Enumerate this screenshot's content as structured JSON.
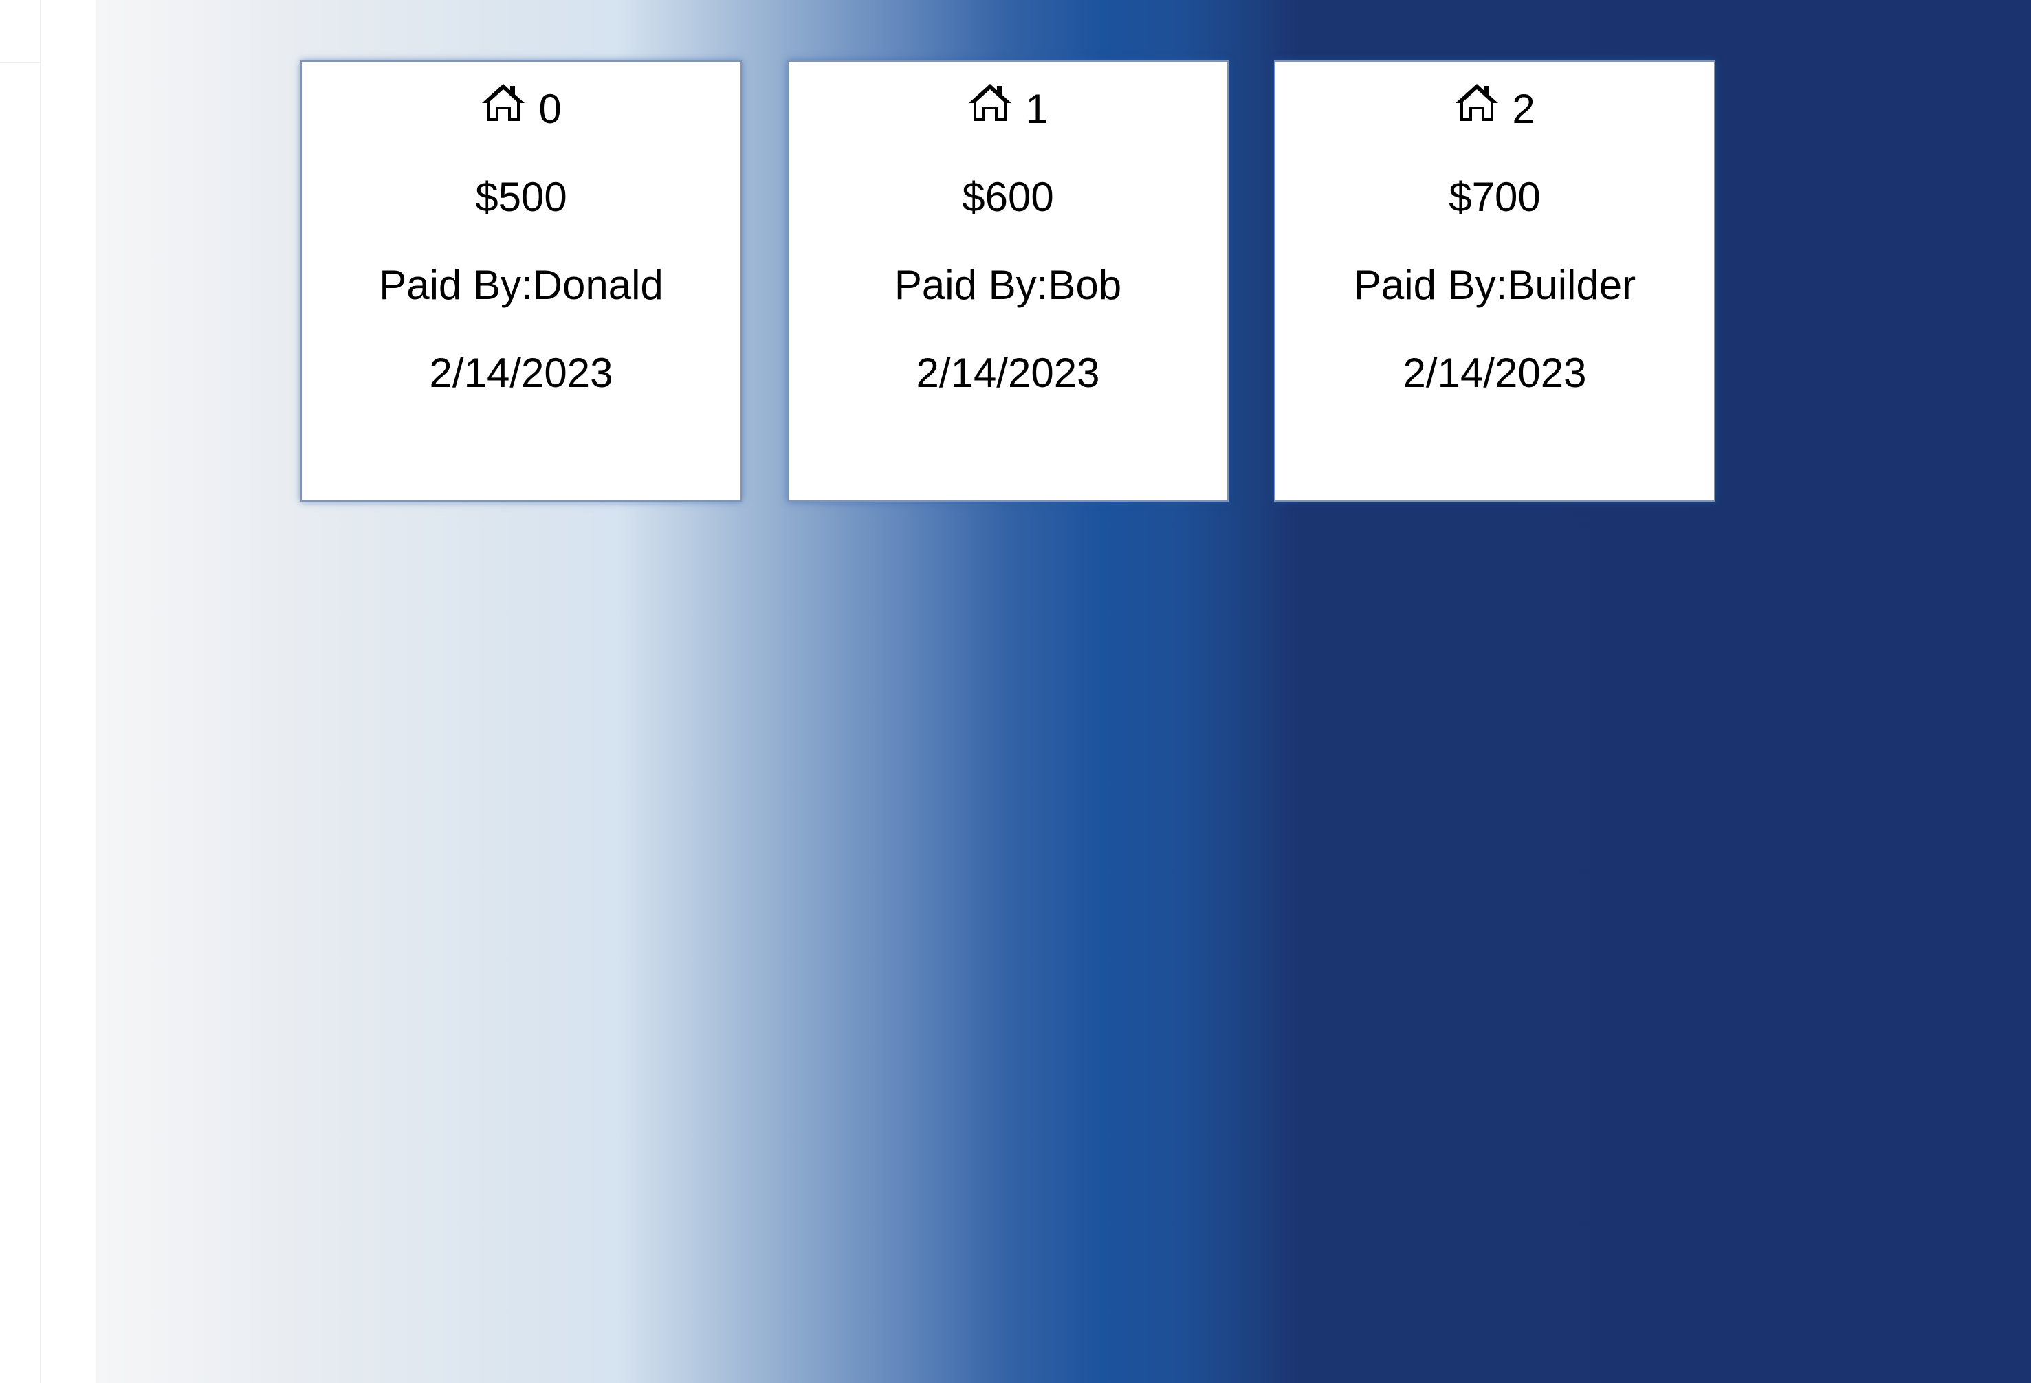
{
  "cards": [
    {
      "number": "0",
      "amount": "$500",
      "paid_by": "Paid By:Donald",
      "date": "2/14/2023",
      "icon": "home-icon"
    },
    {
      "number": "1",
      "amount": "$600",
      "paid_by": "Paid By:Bob",
      "date": "2/14/2023",
      "icon": "home-icon"
    },
    {
      "number": "2",
      "amount": "$700",
      "paid_by": "Paid By:Builder",
      "date": "2/14/2023",
      "icon": "home-icon"
    }
  ],
  "colors": {
    "gradient_light": "#f6f6f7",
    "gradient_mid": "#d6e3f0",
    "gradient_blue": "#1c539d",
    "gradient_dark": "#1b3470",
    "card_border": "#7f95b3"
  }
}
